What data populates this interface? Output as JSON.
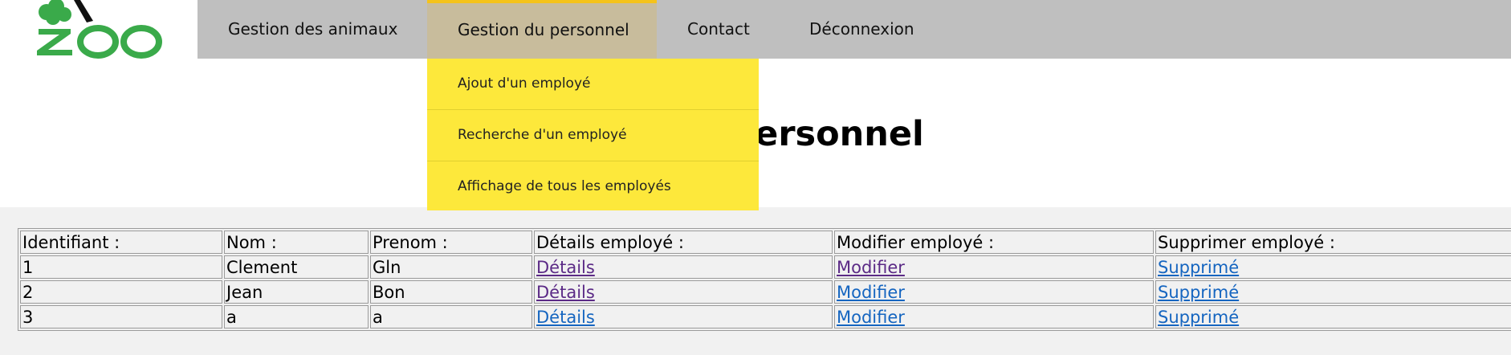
{
  "logo": {
    "text": "ZOO",
    "icon": "tree-icon"
  },
  "nav": {
    "items": [
      {
        "label": "Gestion des animaux",
        "active": false
      },
      {
        "label": "Gestion du personnel",
        "active": true
      },
      {
        "label": "Contact",
        "active": false
      },
      {
        "label": "Déconnexion",
        "active": false
      }
    ],
    "dropdown": [
      {
        "label": "Ajout d'un employé"
      },
      {
        "label": "Recherche d'un employé"
      },
      {
        "label": "Affichage de tous les employés"
      }
    ]
  },
  "page": {
    "title": "Tout le personnel"
  },
  "table": {
    "headers": [
      "Identifiant :",
      "Nom :",
      "Prenom :",
      "Détails employé :",
      "Modifier employé :",
      "Supprimer employé :"
    ],
    "rows": [
      {
        "id": "1",
        "nom": "Clement",
        "prenom": "Gln",
        "details": "Détails",
        "modifier": "Modifier",
        "supprimer": "Supprimé"
      },
      {
        "id": "2",
        "nom": "Jean",
        "prenom": "Bon",
        "details": "Détails",
        "modifier": "Modifier",
        "supprimer": "Supprimé"
      },
      {
        "id": "3",
        "nom": "a",
        "prenom": "a",
        "details": "Détails",
        "modifier": "Modifier",
        "supprimer": "Supprimé"
      }
    ]
  },
  "colors": {
    "logo_green": "#3aaa4a",
    "nav_bg": "#bfbfbf",
    "nav_active": "#c8bc9c",
    "nav_active_top": "#f5c31a",
    "dropdown_bg": "#fde83b",
    "link": "#1565c0",
    "link_visited": "#5b2a86"
  }
}
